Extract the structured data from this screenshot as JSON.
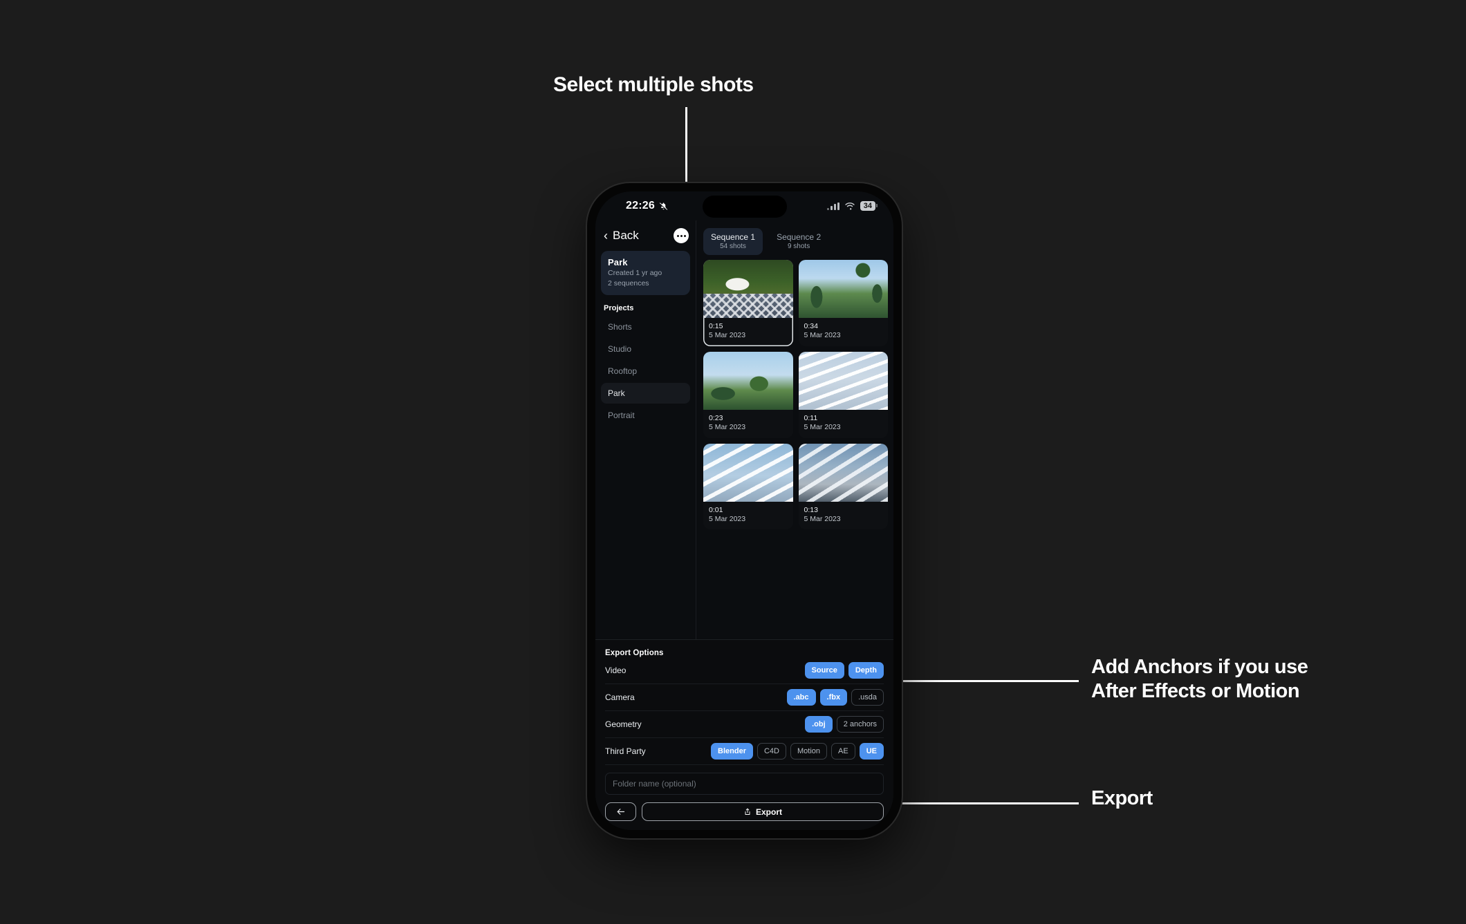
{
  "annotations": {
    "top": "Select multiple shots",
    "right": "Add Anchors if you use\nAfter Effects or Motion",
    "export": "Export"
  },
  "status_bar": {
    "time": "22:26",
    "silent_icon": "bell-slash-icon",
    "signal_icon": "cellular-bars-icon",
    "wifi_icon": "wifi-icon",
    "battery_level": "34"
  },
  "nav": {
    "back_label": "Back",
    "back_icon": "chevron-left-icon",
    "more_icon": "ellipsis-icon"
  },
  "project_card": {
    "title": "Park",
    "created": "Created 1 yr ago",
    "sequences": "2 sequences"
  },
  "sidebar": {
    "heading": "Projects",
    "items": [
      {
        "label": "Shorts",
        "active": false
      },
      {
        "label": "Studio",
        "active": false
      },
      {
        "label": "Rooftop",
        "active": false
      },
      {
        "label": "Park",
        "active": true
      },
      {
        "label": "Portrait",
        "active": false
      }
    ]
  },
  "sequences": [
    {
      "name": "Sequence 1",
      "count": "54 shots",
      "active": true
    },
    {
      "name": "Sequence 2",
      "count": "9 shots",
      "active": false
    }
  ],
  "shots": [
    {
      "duration": "0:15",
      "date": "5 Mar 2023",
      "selected": true,
      "art": "t1"
    },
    {
      "duration": "0:34",
      "date": "5 Mar 2023",
      "selected": false,
      "art": "t2"
    },
    {
      "duration": "0:23",
      "date": "5 Mar 2023",
      "selected": false,
      "art": "t3"
    },
    {
      "duration": "0:11",
      "date": "5 Mar 2023",
      "selected": false,
      "art": "t4"
    },
    {
      "duration": "0:01",
      "date": "5 Mar 2023",
      "selected": false,
      "art": "t5"
    },
    {
      "duration": "0:13",
      "date": "5 Mar 2023",
      "selected": false,
      "art": "t6"
    }
  ],
  "export_options": {
    "title": "Export Options",
    "rows": [
      {
        "label": "Video",
        "chips": [
          {
            "label": "Source",
            "on": true
          },
          {
            "label": "Depth",
            "on": true
          }
        ]
      },
      {
        "label": "Camera",
        "chips": [
          {
            "label": ".abc",
            "on": true
          },
          {
            "label": ".fbx",
            "on": true
          },
          {
            "label": ".usda",
            "on": false
          }
        ]
      },
      {
        "label": "Geometry",
        "chips": [
          {
            "label": ".obj",
            "on": true
          },
          {
            "label": "2 anchors",
            "on": false
          }
        ]
      },
      {
        "label": "Third Party",
        "chips": [
          {
            "label": "Blender",
            "on": true
          },
          {
            "label": "C4D",
            "on": false
          },
          {
            "label": "Motion",
            "on": false
          },
          {
            "label": "AE",
            "on": false
          },
          {
            "label": "UE",
            "on": true
          }
        ]
      }
    ]
  },
  "folder_input": {
    "placeholder": "Folder name (optional)",
    "value": ""
  },
  "bottom_bar": {
    "back_icon": "arrow-left-icon",
    "export_label": "Export",
    "export_icon": "share-up-icon"
  },
  "colors": {
    "page_background": "#1c1c1c",
    "accent_blue": "#4d92ee",
    "card_blue": "#1b2330",
    "screen_background": "#0b0d10"
  }
}
